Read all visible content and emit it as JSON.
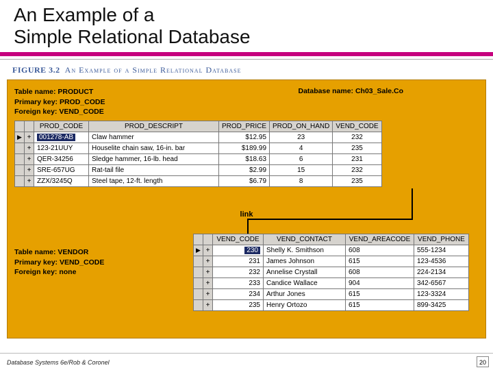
{
  "title_line1": "An Example of a",
  "title_line2": "Simple Relational Database",
  "figure_number": "FIGURE 3.2",
  "figure_caption": "An Example of a Simple Relational Database",
  "database_label": "Database name:",
  "database_name": "Ch03_Sale.Co",
  "product": {
    "table_label": "Table name:",
    "table_name": "PRODUCT",
    "pk_label": "Primary key:",
    "pk": "PROD_CODE",
    "fk_label": "Foreign key:",
    "fk": "VEND_CODE",
    "columns": [
      "PROD_CODE",
      "PROD_DESCRIPT",
      "PROD_PRICE",
      "PROD_ON_HAND",
      "VEND_CODE"
    ],
    "rows": [
      {
        "code": "001278-AB",
        "descript": "Claw hammer",
        "price": "$12.95",
        "on_hand": "23",
        "vend": "232",
        "selected": true,
        "code_highlighted": true
      },
      {
        "code": "123-21UUY",
        "descript": "Houselite chain saw, 16-in. bar",
        "price": "$189.99",
        "on_hand": "4",
        "vend": "235",
        "selected": false,
        "code_highlighted": false
      },
      {
        "code": "QER-34256",
        "descript": "Sledge hammer, 16-lb. head",
        "price": "$18.63",
        "on_hand": "6",
        "vend": "231",
        "selected": false,
        "code_highlighted": false
      },
      {
        "code": "SRE-657UG",
        "descript": "Rat-tail file",
        "price": "$2.99",
        "on_hand": "15",
        "vend": "232",
        "selected": false,
        "code_highlighted": false
      },
      {
        "code": "ZZX/3245Q",
        "descript": "Steel tape, 12-ft. length",
        "price": "$6.79",
        "on_hand": "8",
        "vend": "235",
        "selected": false,
        "code_highlighted": false
      }
    ]
  },
  "link_label": "link",
  "vendor": {
    "table_label": "Table name:",
    "table_name": "VENDOR",
    "pk_label": "Primary key:",
    "pk": "VEND_CODE",
    "fk_label": "Foreign key:",
    "fk": "none",
    "columns": [
      "VEND_CODE",
      "VEND_CONTACT",
      "VEND_AREACODE",
      "VEND_PHONE"
    ],
    "rows": [
      {
        "code": "230",
        "contact": "Shelly K. Smithson",
        "area": "608",
        "phone": "555-1234",
        "selected": true,
        "code_highlighted": true
      },
      {
        "code": "231",
        "contact": "James Johnson",
        "area": "615",
        "phone": "123-4536",
        "selected": false,
        "code_highlighted": false
      },
      {
        "code": "232",
        "contact": "Annelise Crystall",
        "area": "608",
        "phone": "224-2134",
        "selected": false,
        "code_highlighted": false
      },
      {
        "code": "233",
        "contact": "Candice Wallace",
        "area": "904",
        "phone": "342-6567",
        "selected": false,
        "code_highlighted": false
      },
      {
        "code": "234",
        "contact": "Arthur Jones",
        "area": "615",
        "phone": "123-3324",
        "selected": false,
        "code_highlighted": false
      },
      {
        "code": "235",
        "contact": "Henry Ortozo",
        "area": "615",
        "phone": "899-3425",
        "selected": false,
        "code_highlighted": false
      }
    ]
  },
  "footer_text": "Database Systems 6e/Rob & Coronel",
  "page_number": "20",
  "glyphs": {
    "row_pointer": "▶",
    "expand": "+"
  }
}
